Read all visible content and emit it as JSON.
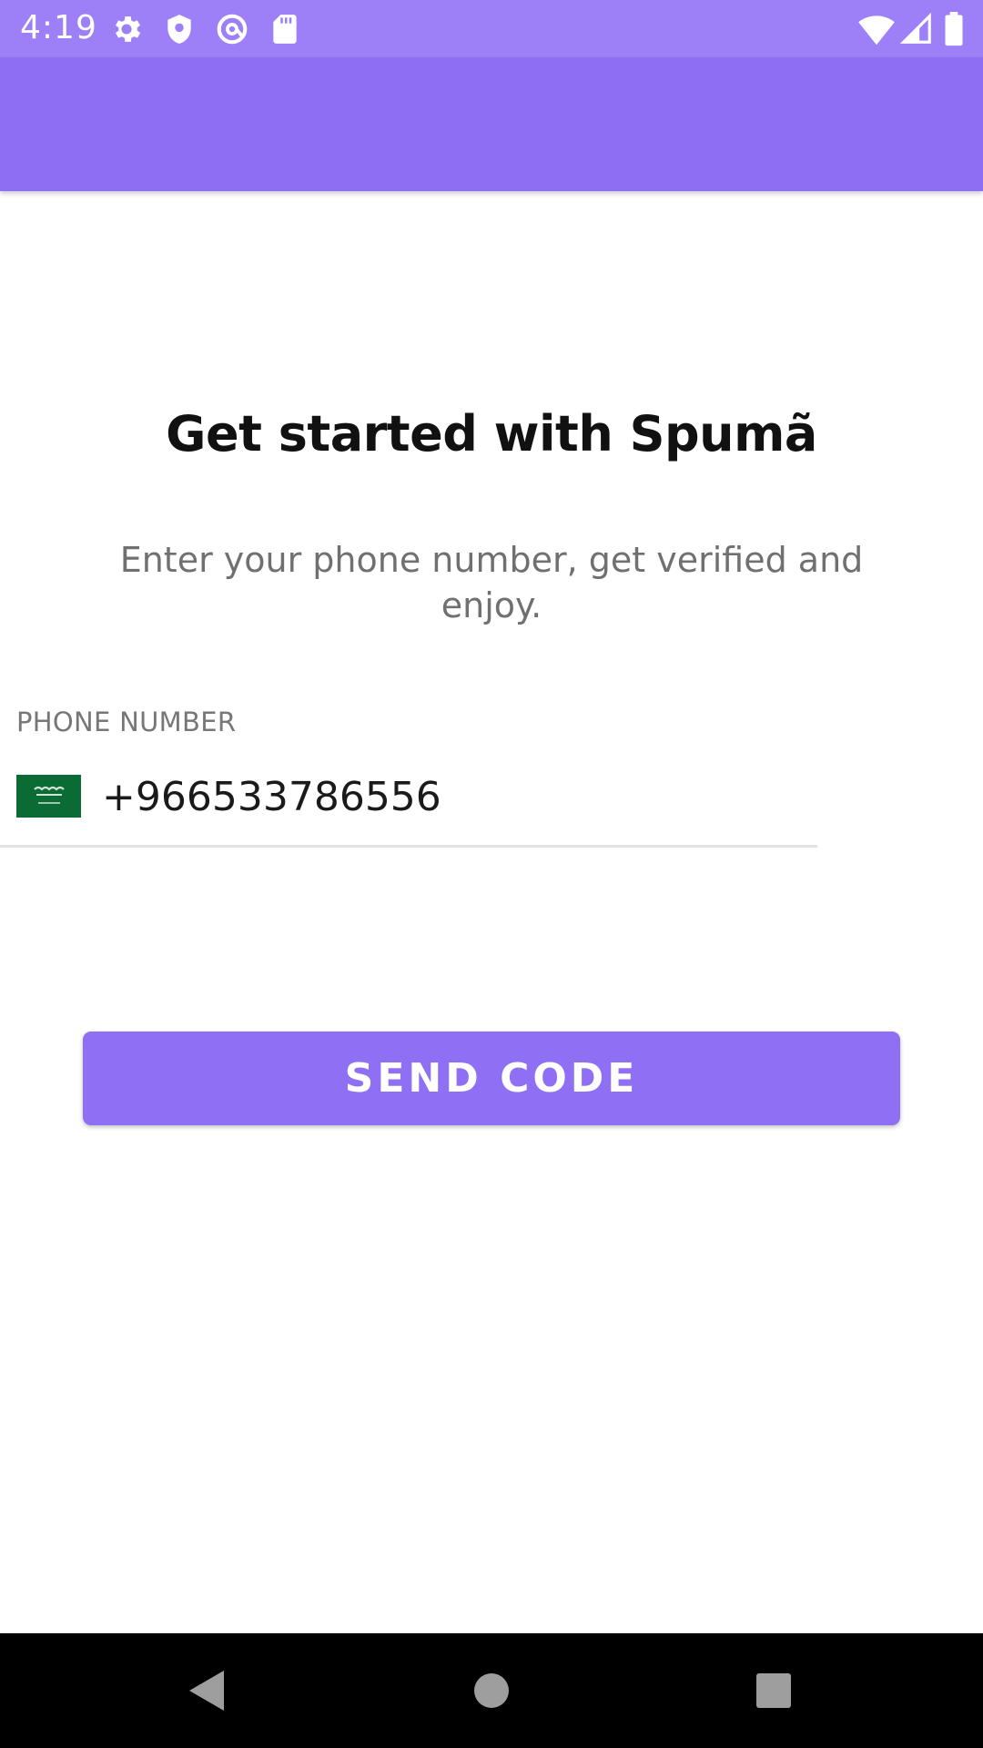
{
  "status_bar": {
    "time": "4:19",
    "left_icons": [
      "gear-icon",
      "shield-icon",
      "at-sign-icon",
      "sd-card-icon"
    ],
    "right_icons": [
      "wifi-icon",
      "cell-signal-icon",
      "battery-icon"
    ]
  },
  "main": {
    "title": "Get started with Spumã",
    "subtitle": "Enter your phone number, get verified and enjoy.",
    "phone_label": "PHONE NUMBER",
    "phone_value": "+966533786556",
    "country_flag": "saudi-arabia-flag-icon",
    "send_button_label": "SEND CODE"
  },
  "nav_bar": {
    "icons": [
      "back-icon",
      "home-icon",
      "recents-icon"
    ]
  },
  "colors": {
    "status_bar": "#9d80f7",
    "app_bar": "#8e6ff4",
    "accent": "#8f6ff3",
    "flag_green": "#0b6b34"
  }
}
